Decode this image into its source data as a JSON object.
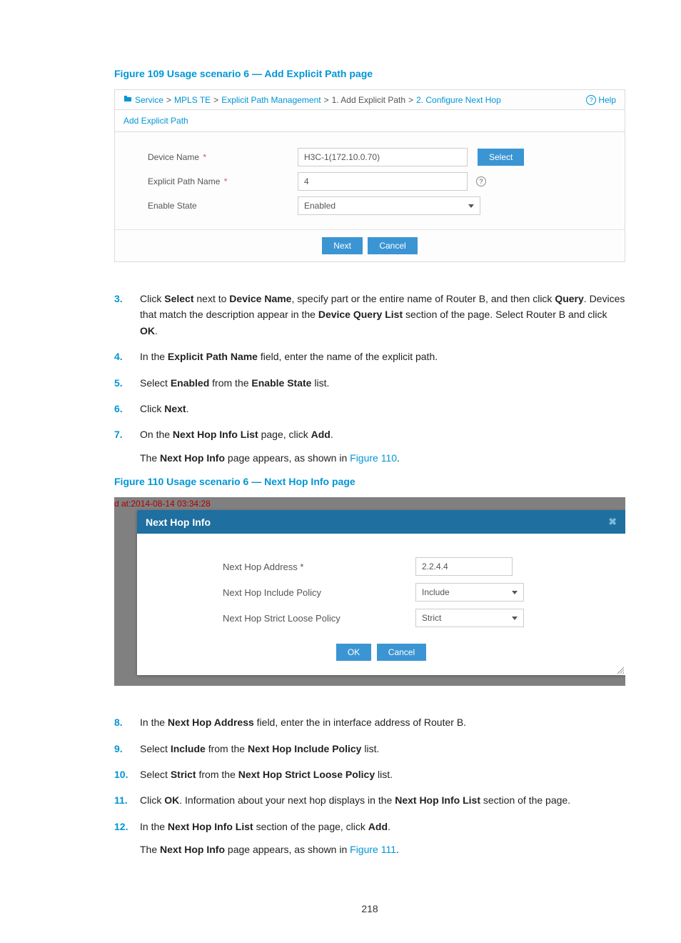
{
  "figure1": {
    "caption": "Figure 109 Usage scenario 6 — Add Explicit Path page",
    "breadcrumb": {
      "b1": "Service",
      "b2": "MPLS TE",
      "b3": "Explicit Path Management",
      "b4": "1. Add Explicit Path",
      "b5": "2. Configure Next Hop"
    },
    "help": "Help",
    "panel_title": "Add Explicit Path",
    "device_name_label": "Device Name",
    "device_name_value": "H3C-1(172.10.0.70)",
    "select_btn": "Select",
    "explicit_path_label": "Explicit Path Name",
    "explicit_path_value": "4",
    "enable_state_label": "Enable State",
    "enable_state_value": "Enabled",
    "next_btn": "Next",
    "cancel_btn": "Cancel"
  },
  "steps_a": {
    "s3": {
      "num": "3.",
      "t1": "Click ",
      "b1": "Select",
      "t2": " next to ",
      "b2": "Device Name",
      "t3": ", specify part or the entire name of Router B, and then click ",
      "b3": "Query",
      "t4": ". Devices that match the description appear in the ",
      "b4": "Device Query List",
      "t5": " section of the page. Select Router B and click ",
      "b5": "OK",
      "t6": "."
    },
    "s4": {
      "num": "4.",
      "t1": "In the ",
      "b1": "Explicit Path Name",
      "t2": " field, enter the name of the explicit path."
    },
    "s5": {
      "num": "5.",
      "t1": "Select ",
      "b1": "Enabled",
      "t2": " from the ",
      "b2": "Enable State",
      "t3": " list."
    },
    "s6": {
      "num": "6.",
      "t1": "Click ",
      "b1": "Next",
      "t2": "."
    },
    "s7": {
      "num": "7.",
      "t1": "On the ",
      "b1": "Next Hop Info List",
      "t2": " page, click ",
      "b2": "Add",
      "t3": ".",
      "sub_t1": "The ",
      "sub_b1": "Next Hop Info",
      "sub_t2": " page appears, as shown in ",
      "sub_link": "Figure 110",
      "sub_t3": "."
    }
  },
  "figure2": {
    "caption": "Figure 110 Usage scenario 6 — Next Hop Info page",
    "ts": "d at:2014-08-14 03:34:28",
    "header": "Next Hop Info",
    "addr_label": "Next Hop Address",
    "addr_value": "2.2.4.4",
    "include_label": "Next Hop Include Policy",
    "include_value": "Include",
    "strict_label": "Next Hop Strict Loose Policy",
    "strict_value": "Strict",
    "ok_btn": "OK",
    "cancel_btn": "Cancel"
  },
  "steps_b": {
    "s8": {
      "num": "8.",
      "t1": "In the ",
      "b1": "Next Hop Address",
      "t2": " field, enter the in interface address of Router B."
    },
    "s9": {
      "num": "9.",
      "t1": "Select ",
      "b1": "Include",
      "t2": " from the ",
      "b2": "Next Hop Include Policy",
      "t3": " list."
    },
    "s10": {
      "num": "10.",
      "t1": "Select ",
      "b1": "Strict",
      "t2": " from the ",
      "b2": "Next Hop Strict Loose Policy",
      "t3": " list."
    },
    "s11": {
      "num": "11.",
      "t1": "Click ",
      "b1": "OK",
      "t2": ". Information about your next hop displays in the ",
      "b2": "Next Hop Info List",
      "t3": " section of the page."
    },
    "s12": {
      "num": "12.",
      "t1": "In the ",
      "b1": "Next Hop Info List",
      "t2": " section of the page, click ",
      "b2": "Add",
      "t3": ".",
      "sub_t1": "The ",
      "sub_b1": "Next Hop Info",
      "sub_t2": " page appears, as shown in ",
      "sub_link": "Figure 111",
      "sub_t3": "."
    }
  },
  "page_number": "218"
}
